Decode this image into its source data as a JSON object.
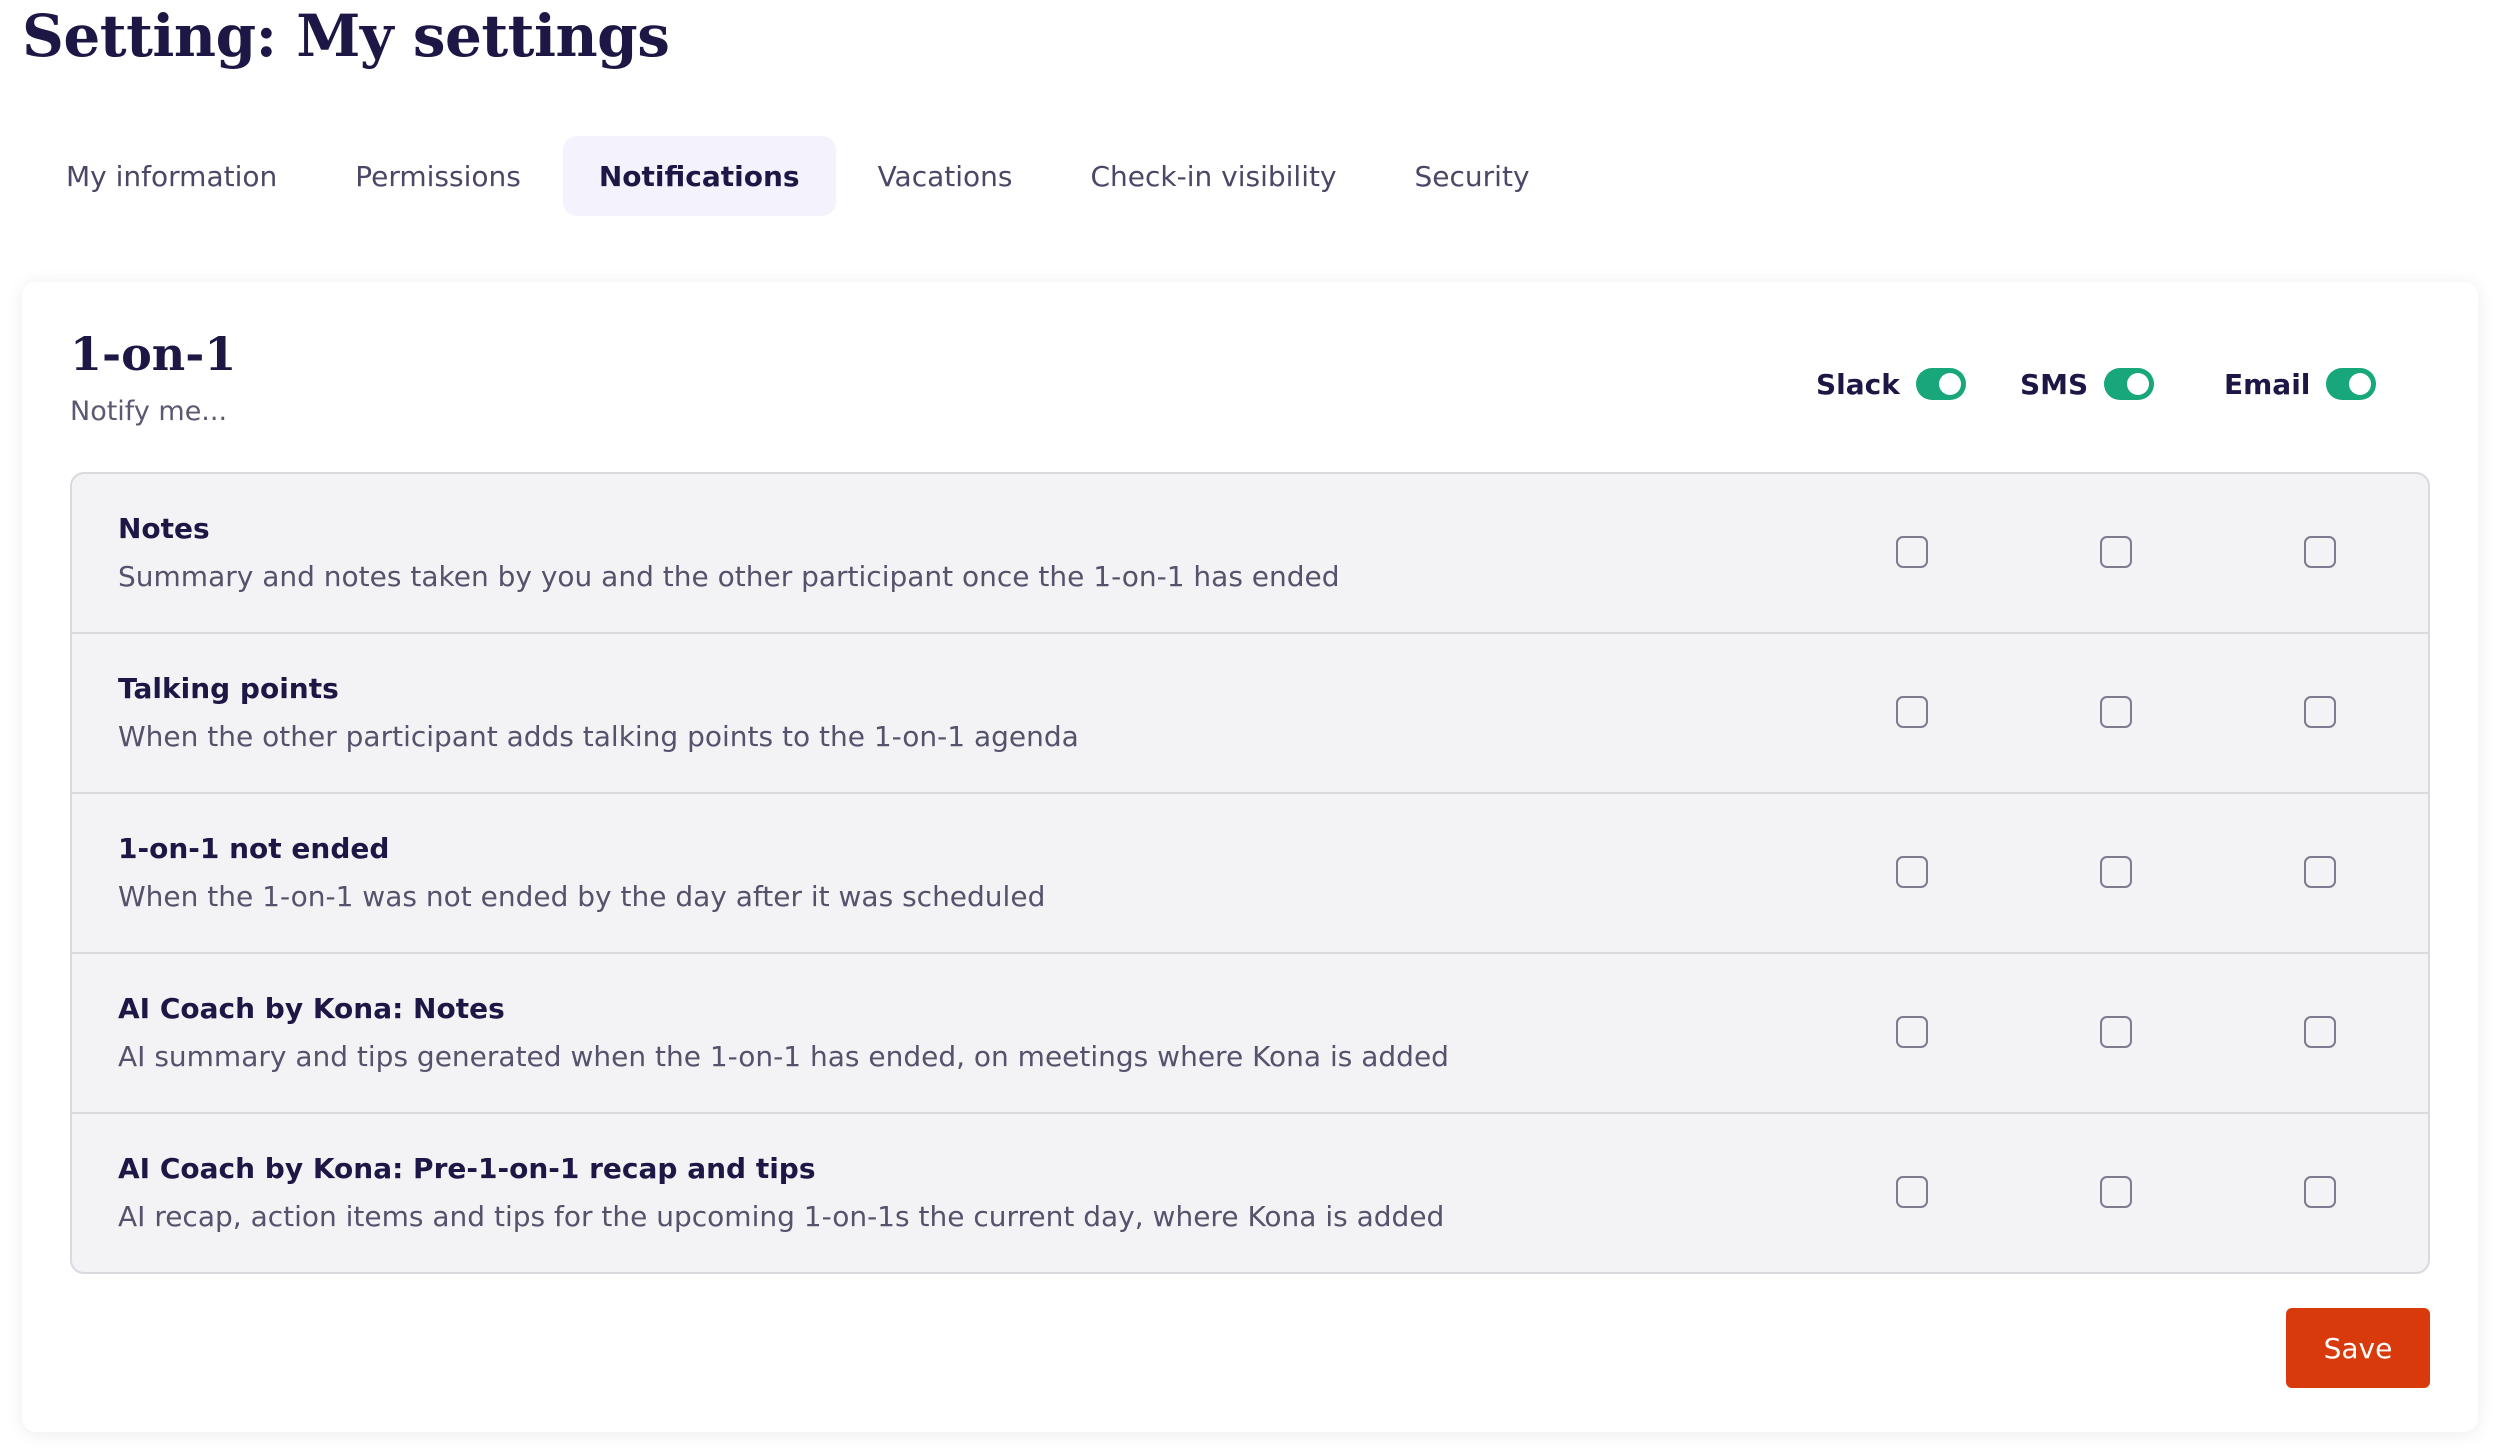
{
  "page": {
    "title": "Setting: My settings"
  },
  "tabs": [
    {
      "label": "My information",
      "active": false
    },
    {
      "label": "Permissions",
      "active": false
    },
    {
      "label": "Notifications",
      "active": true
    },
    {
      "label": "Vacations",
      "active": false
    },
    {
      "label": "Check-in visibility",
      "active": false
    },
    {
      "label": "Security",
      "active": false
    }
  ],
  "section": {
    "title": "1-on-1",
    "subtitle": "Notify me..."
  },
  "channels": [
    {
      "label": "Slack",
      "enabled": true
    },
    {
      "label": "SMS",
      "enabled": true
    },
    {
      "label": "Email",
      "enabled": true
    }
  ],
  "rows": [
    {
      "title": "Notes",
      "description": "Summary and notes taken by you and the other participant once the 1-on-1 has ended",
      "checked": [
        false,
        false,
        false
      ]
    },
    {
      "title": "Talking points",
      "description": "When the other participant adds talking points to the 1-on-1 agenda",
      "checked": [
        false,
        false,
        false
      ]
    },
    {
      "title": "1-on-1 not ended",
      "description": "When the 1-on-1 was not ended by the day after it was scheduled",
      "checked": [
        false,
        false,
        false
      ]
    },
    {
      "title": "AI Coach by Kona: Notes",
      "description": "AI summary and tips generated when the 1-on-1 has ended, on meetings where Kona is added",
      "checked": [
        false,
        false,
        false
      ]
    },
    {
      "title": "AI Coach by Kona: Pre-1-on-1 recap and tips",
      "description": "AI recap, action items and tips for the upcoming 1-on-1s the current day, where Kona is added",
      "checked": [
        false,
        false,
        false
      ]
    }
  ],
  "actions": {
    "save_label": "Save"
  },
  "colors": {
    "title": "#1d1745",
    "active_tab_bg": "#f3f2fd",
    "toggle_on": "#18a77a",
    "table_bg": "#f3f3f5",
    "save_button": "#d93a0b"
  }
}
